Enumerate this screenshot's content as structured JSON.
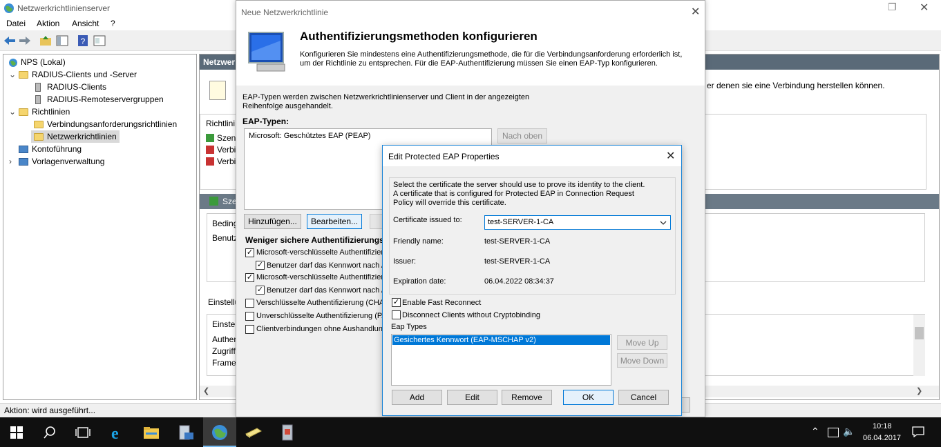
{
  "nps": {
    "title": "Netzwerkrichtlinienserver",
    "menu": [
      "Datei",
      "Aktion",
      "Ansicht",
      "?"
    ],
    "tree": [
      {
        "label": "NPS (Lokal)"
      },
      {
        "label": "RADIUS-Clients und -Server"
      },
      {
        "label": "RADIUS-Clients"
      },
      {
        "label": "RADIUS-Remoteservergruppen"
      },
      {
        "label": "Richtlinien"
      },
      {
        "label": "Verbindungsanforderungsrichtlinien"
      },
      {
        "label": "Netzwerkrichtlinien"
      },
      {
        "label": "Kontoführung"
      },
      {
        "label": "Vorlagenverwaltung"
      }
    ],
    "right_header": "Netzwer",
    "right_desc": "er denen sie eine Verbindung herstellen können.",
    "richtlinien_label": "Richtlini",
    "policy_items": [
      "Szena",
      "Verbin",
      "Verbin"
    ],
    "szenario_label": "Szer",
    "conditions": [
      "Beding",
      "Benutz"
    ],
    "settings_label": "Einstellu",
    "settings_items": [
      "Einstell",
      "Authen",
      "Zugriffs",
      "Framed"
    ],
    "status": "Aktion:  wird ausgeführt..."
  },
  "wizard": {
    "title": "Neue Netzwerkrichtlinie",
    "heading": "Authentifizierungsmethoden konfigurieren",
    "desc_line1": "Konfigurieren Sie mindestens eine Authentifizierungsmethode, die für die Verbindungsanforderung erforderlich ist,",
    "desc_line2": "um der Richtlinie zu entsprechen. Für die EAP-Authentifizierung müssen Sie einen EAP-Typ konfigurieren.",
    "eap_intro_line1": "EAP-Typen werden zwischen Netzwerkrichtlinienserver und Client in der angezeigten",
    "eap_intro_line2": "Reihenfolge ausgehandelt.",
    "eap_types_label": "EAP-Typen:",
    "eap_types": [
      "Microsoft: Geschütztes EAP (PEAP)"
    ],
    "move_up": "Nach oben",
    "add": "Hinzufügen...",
    "edit": "Bearbeiten...",
    "less_secure_label": "Weniger sichere Authentifizierungsr",
    "options": [
      {
        "label": "Microsoft-verschlüsselte Authentifizieru",
        "checked": true
      },
      {
        "label": "Benutzer darf das Kennwort nach A",
        "checked": true
      },
      {
        "label": "Microsoft-verschlüsselte Authentifizieru",
        "checked": true
      },
      {
        "label": "Benutzer darf das Kennwort nach A",
        "checked": true
      },
      {
        "label": "Verschlüsselte Authentifizierung (CHAP",
        "checked": false
      },
      {
        "label": "Unverschlüsselte Authentifizierung (PA",
        "checked": false
      },
      {
        "label": "Clientverbindungen ohne Aushandlung",
        "checked": false
      }
    ]
  },
  "eap_dialog": {
    "title": "Edit Protected EAP Properties",
    "intro_line1": "Select the certificate the server should use to prove its identity to the client.",
    "intro_line2": "A certificate that is configured for Protected EAP in Connection Request",
    "intro_line3": "Policy will override this certificate.",
    "cert_label": "Certificate issued to:",
    "cert_value": "test-SERVER-1-CA",
    "friendly_label": "Friendly name:",
    "friendly_value": "test-SERVER-1-CA",
    "issuer_label": "Issuer:",
    "issuer_value": "test-SERVER-1-CA",
    "expiration_label": "Expiration date:",
    "expiration_value": "06.04.2022 08:34:37",
    "fast_reconnect": "Enable Fast Reconnect",
    "disconnect_clients": "Disconnect Clients without Cryptobinding",
    "eap_types_label": "Eap Types",
    "eap_types": [
      "Gesichertes Kennwort (EAP-MSCHAP v2)"
    ],
    "move_up": "Move Up",
    "move_down": "Move Down",
    "add": "Add",
    "edit": "Edit",
    "remove": "Remove",
    "ok": "OK",
    "cancel": "Cancel"
  },
  "taskbar": {
    "time": "10:18",
    "date": "06.04.2017"
  },
  "colors": {
    "accent": "#0078d7",
    "selection": "#0078d7",
    "taskbar": "#101010"
  }
}
